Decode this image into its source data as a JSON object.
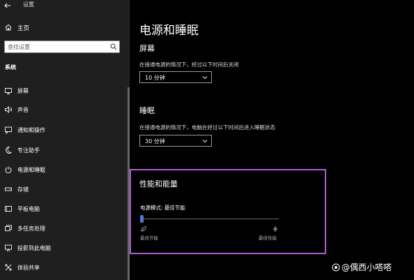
{
  "window": {
    "title": "设置"
  },
  "sidebar": {
    "home_label": "主页",
    "search_placeholder": "查找设置",
    "section_label": "系统",
    "items": [
      {
        "label": "屏幕",
        "icon": "monitor-icon"
      },
      {
        "label": "声音",
        "icon": "speaker-icon"
      },
      {
        "label": "通知和操作",
        "icon": "notification-icon"
      },
      {
        "label": "专注助手",
        "icon": "moon-icon"
      },
      {
        "label": "电源和睡眠",
        "icon": "power-icon"
      },
      {
        "label": "存储",
        "icon": "storage-icon"
      },
      {
        "label": "平板电脑",
        "icon": "tablet-icon"
      },
      {
        "label": "多任务处理",
        "icon": "multitask-icon"
      },
      {
        "label": "投影到此电脑",
        "icon": "project-icon"
      },
      {
        "label": "体验共享",
        "icon": "share-icon"
      }
    ]
  },
  "main": {
    "page_title": "电源和睡眠",
    "screen": {
      "heading": "屏幕",
      "description": "在接通电源的情况下，经过以下时间后关闭",
      "value": "10 分钟"
    },
    "sleep": {
      "heading": "睡眠",
      "description": "在接通电源的情况下，电脑在经过以下时间后进入睡眠状态",
      "value": "30 分钟"
    },
    "performance": {
      "heading": "性能和能量",
      "mode_label": "电源模式: 最佳节能",
      "slider_level": 0,
      "left_label": "最佳节能",
      "right_label": "最佳性能",
      "accent": "#4a7bd8",
      "highlight": "#b05bd6"
    }
  },
  "watermark": {
    "text": "@偶西小嗒嗒"
  }
}
